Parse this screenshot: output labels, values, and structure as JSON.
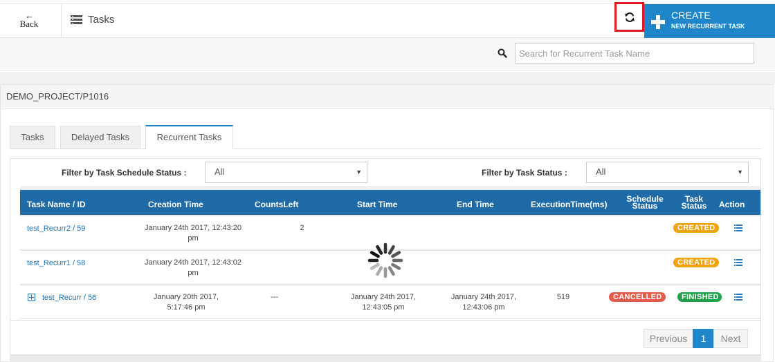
{
  "header": {
    "back_arrow": "←",
    "back_label": "Back",
    "section_title": "Tasks",
    "create_line1": "CREATE",
    "create_line2": "NEW RECURRENT TASK"
  },
  "search": {
    "placeholder": "Search for Recurrent Task Name",
    "value": ""
  },
  "project": {
    "path": "DEMO_PROJECT/P1016"
  },
  "tabs": [
    {
      "label": "Tasks",
      "active": false
    },
    {
      "label": "Delayed Tasks",
      "active": false
    },
    {
      "label": "Recurrent Tasks",
      "active": true
    }
  ],
  "filters": {
    "schedule_label": "Filter by Task Schedule Status :",
    "schedule_value": "All",
    "status_label": "Filter by Task Status :",
    "status_value": "All"
  },
  "table": {
    "columns": {
      "name": "Task Name / ID",
      "creation": "Creation Time",
      "counts": "CountsLeft",
      "start": "Start Time",
      "end": "End Time",
      "exec": "ExecutionTime(ms)",
      "schedule_1": "Schedule",
      "schedule_2": "Status",
      "task_status_1": "Task",
      "task_status_2": "Status",
      "action": "Action"
    },
    "rows": [
      {
        "name": "test_Recurr2 / 59",
        "creation_1": "January 24th 2017, 12:43:20",
        "creation_2": "pm",
        "counts": "2",
        "start_1": "",
        "start_2": "",
        "end_1": "",
        "end_2": "",
        "exec": "",
        "schedule_status": "",
        "task_status": "CREATED"
      },
      {
        "name": "test_Recurr1 / 58",
        "creation_1": "January 24th 2017, 12:43:02",
        "creation_2": "pm",
        "counts": "",
        "start_1": "",
        "start_2": "",
        "end_1": "",
        "end_2": "",
        "exec": "",
        "schedule_status": "",
        "task_status": "CREATED"
      },
      {
        "name": "test_Recurr / 56",
        "creation_1": "January 20th 2017,",
        "creation_2": "5:17:46 pm",
        "counts": "---",
        "start_1": "January 24th 2017,",
        "start_2": "12:43:05 pm",
        "end_1": "January 24th 2017,",
        "end_2": "12:43:06 pm",
        "exec": "519",
        "schedule_status": "CANCELLED",
        "task_status": "FINISHED"
      }
    ]
  },
  "pagination": {
    "previous": "Previous",
    "current": "1",
    "next": "Next"
  },
  "colors": {
    "primary": "#1f87c9",
    "table_header": "#1f6ba8",
    "created": "#f0a30a",
    "finished": "#1ea34a",
    "cancelled": "#e35b4b",
    "highlight_border": "#e0181f"
  },
  "icons": {
    "back": "arrow-left-icon",
    "tasks": "list-icon",
    "refresh": "refresh-icon",
    "create": "plus-icon",
    "search": "search-icon",
    "action": "list-details-icon",
    "expand": "expand-plus-icon",
    "loading": "loading-spinner-icon"
  }
}
